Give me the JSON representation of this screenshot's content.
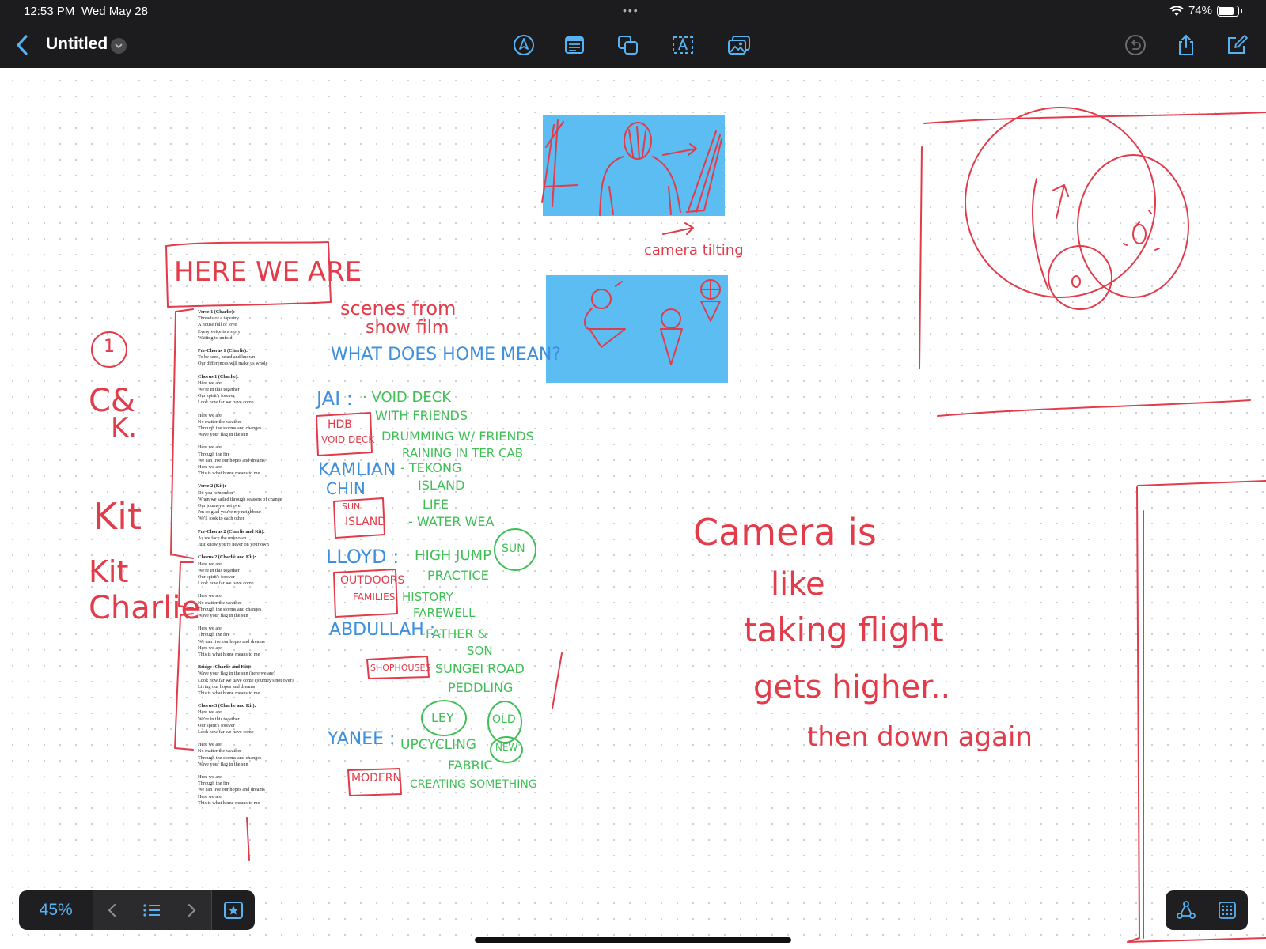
{
  "status_bar": {
    "time": "12:53 PM",
    "date": "Wed May 28",
    "battery": "74%",
    "battery_level": 0.74
  },
  "header": {
    "title": "Untitled",
    "tools": [
      "pen-tool-icon",
      "text-box-icon",
      "shapes-icon",
      "text-icon",
      "image-icon"
    ],
    "right_actions": [
      "undo-icon",
      "share-icon",
      "compose-icon"
    ]
  },
  "colors": {
    "chrome": "#1c1c1e",
    "accent": "#57b2f2",
    "ink_red": "#e23b4a",
    "ink_blue": "#3e8fdc",
    "ink_green": "#3fbf55",
    "image_fill": "#5bbdf2"
  },
  "canvas": {
    "heading": "HERE WE ARE",
    "sidebar_notes": {
      "circle_number": "1",
      "c_and_k": "C&",
      "k_letter": "K.",
      "kit": "Kit",
      "kit_charlie_1": "Kit",
      "kit_charlie_2": "Charlie"
    },
    "lyrics": [
      {
        "title": "Verse 1 (Charlie):",
        "lines": [
          "Threads of a tapestry",
          "A house full of love",
          "Every voice is a story",
          "Waiting to unfold"
        ]
      },
      {
        "title": "Pre-Chorus 1 (Charlie):",
        "lines": [
          "To be seen, heard and known",
          "Our differences will make us whole"
        ]
      },
      {
        "title": "Chorus 1 (Charlie):",
        "lines": [
          "Here we are",
          "We're in this together",
          "Our spirit's forever",
          "Look how far we have come"
        ]
      },
      {
        "title": "",
        "lines": [
          "Here we are",
          "No matter the weather",
          "Through the storms and changes",
          "Wave your flag in the sun"
        ]
      },
      {
        "title": "",
        "lines": [
          "Here we are",
          "Through the fire",
          "We can live our hopes and dreams",
          "Here we are",
          "This is what home means to me"
        ]
      },
      {
        "title": "Verse 2 (Kit):",
        "lines": [
          "Do you remember",
          "When we sailed through seasons of change",
          "Our journey's not over",
          "I'm so glad you're my neighbour",
          "We'll look to each other"
        ]
      },
      {
        "title": "Pre-Chorus 2 (Charlie and Kit):",
        "lines": [
          "As we face the unknown",
          "Just know you're never on your own"
        ]
      },
      {
        "title": "Chorus 2 (Charlie and Kit):",
        "lines": [
          "Here we are",
          "We're in this together",
          "Our spirit's forever",
          "Look how far we have come"
        ]
      },
      {
        "title": "",
        "lines": [
          "Here we are",
          "No matter the weather",
          "Through the storms and changes",
          "Wave your flag in the sun"
        ]
      },
      {
        "title": "",
        "lines": [
          "Here we are",
          "Through the fire",
          "We can live our hopes and dreams",
          "Here we are",
          "This is what home means to me"
        ]
      },
      {
        "title": "Bridge (Charlie and Kit):",
        "lines": [
          "Wave your flag in the sun (here we are)",
          "Look how far we have come (journey's not over)",
          "Living our hopes and dreams",
          "This is what home means to me"
        ]
      },
      {
        "title": "Chorus 3 (Charlie and Kit):",
        "lines": [
          "Here we are",
          "We're in this together",
          "Our spirit's forever",
          "Look how far we have come"
        ]
      },
      {
        "title": "",
        "lines": [
          "Here we are",
          "No matter the weather",
          "Through the storms and changes",
          "Wave your flag in the sun"
        ]
      },
      {
        "title": "",
        "lines": [
          "Here we are",
          "Through the fire",
          "We can live our hopes and dreams",
          "Here we are",
          "This is what home means to me"
        ]
      }
    ],
    "notes": {
      "scenes_1": "scenes from",
      "scenes_2": "show film",
      "what_home": "WHAT DOES HOME MEAN?",
      "jai": "JAI :",
      "jai_1": "· VOID DECK",
      "jai_2": "WITH FRIENDS",
      "jai_3": "DRUMMING W/ FRIENDS",
      "jai_4": "RAINING IN TER CAB",
      "hdb_1": "HDB",
      "hdb_2": "VOID DECK",
      "kamlian_1": "KAMLIAN",
      "kamlian_2": "CHIN",
      "kam_1": "- TEKONG",
      "kam_2": "ISLAND",
      "kam_3": "LIFE",
      "kam_4": "- WATER WEA",
      "sun_1": "SUN",
      "sun_2": "ISLAND",
      "lloyd": "LLOYD :",
      "lloyd_1": "HIGH JUMP",
      "lloyd_2": "PRACTICE",
      "lloyd_3": "HISTORY",
      "lloyd_4": "FAREWELL",
      "sun_circle": "SUN",
      "outdoor_1": "OUTDOORS",
      "outdoor_2": "FAMILIES",
      "abdullah": "ABDULLAH :",
      "abd_1": "FATHER &",
      "abd_2": "SON",
      "abd_3": "SUNGEI ROAD",
      "abd_4": "PEDDLING",
      "shophouses": "SHOPHOUSES",
      "ley": "LEY",
      "old": "OLD",
      "yanee": "YANEE :",
      "yanee_1": "UPCYCLING",
      "yanee_2": "FABRIC",
      "yanee_3": "CREATING SOMETHING",
      "new": "NEW",
      "modern": "MODERN",
      "camera_tilt": "camera tilting",
      "camera_1": "Camera is",
      "camera_2": "like",
      "camera_3": "taking flight",
      "camera_4": "gets higher..",
      "camera_5": "then down again"
    }
  },
  "bottom_toolbar": {
    "zoom": "45%",
    "icons": [
      "prev-page-icon",
      "page-list-icon",
      "next-page-icon",
      "favorites-icon"
    ],
    "right_icons": [
      "shape-connect-icon",
      "grid-icon"
    ]
  }
}
